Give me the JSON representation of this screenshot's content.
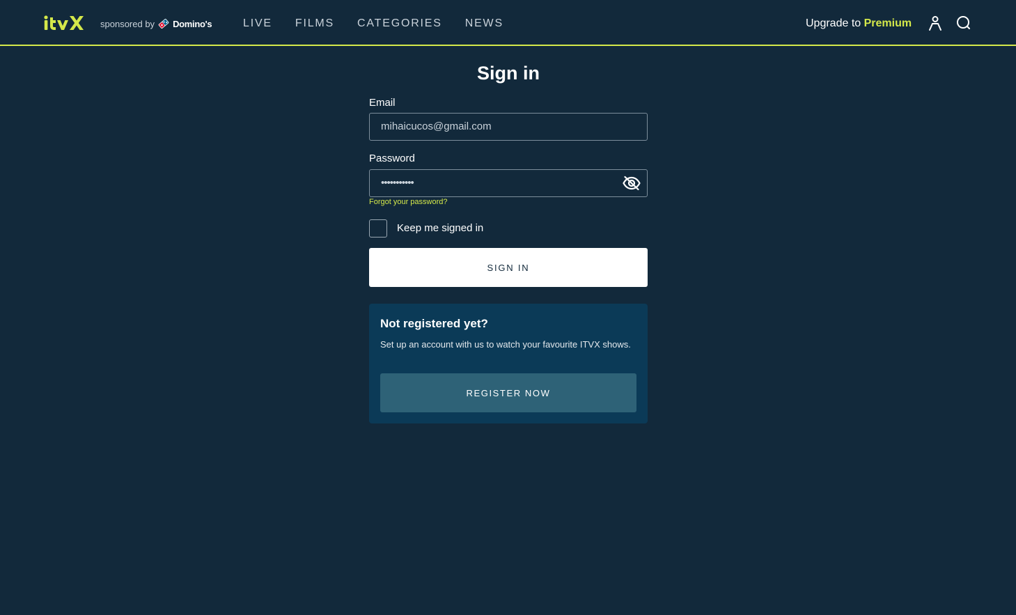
{
  "brand": {
    "logo_text": "itvX",
    "sponsor_prefix": "sponsored by",
    "sponsor_name": "Domino's"
  },
  "nav": {
    "items": [
      {
        "label": "LIVE"
      },
      {
        "label": "FILMS"
      },
      {
        "label": "CATEGORIES"
      },
      {
        "label": "NEWS"
      }
    ]
  },
  "header": {
    "upgrade_prefix": "Upgrade to",
    "upgrade_highlight": "Premium",
    "account_icon": "user-icon",
    "search_icon": "search-icon"
  },
  "signin": {
    "title": "Sign in",
    "email_label": "Email",
    "email_value": "mihaicucos@gmail.com",
    "password_label": "Password",
    "password_value": "•••••••••••",
    "forgot_link": "Forgot your password?",
    "keep_signed_in_label": "Keep me signed in",
    "keep_signed_in_checked": false,
    "submit_label": "SIGN IN"
  },
  "register": {
    "title": "Not registered yet?",
    "description": "Set up an account with us to watch your favourite ITVX shows.",
    "button_label": "REGISTER NOW"
  },
  "colors": {
    "background": "#12293b",
    "accent": "#d4e84a",
    "card": "#0b3a57",
    "register_button": "#2e6277"
  }
}
